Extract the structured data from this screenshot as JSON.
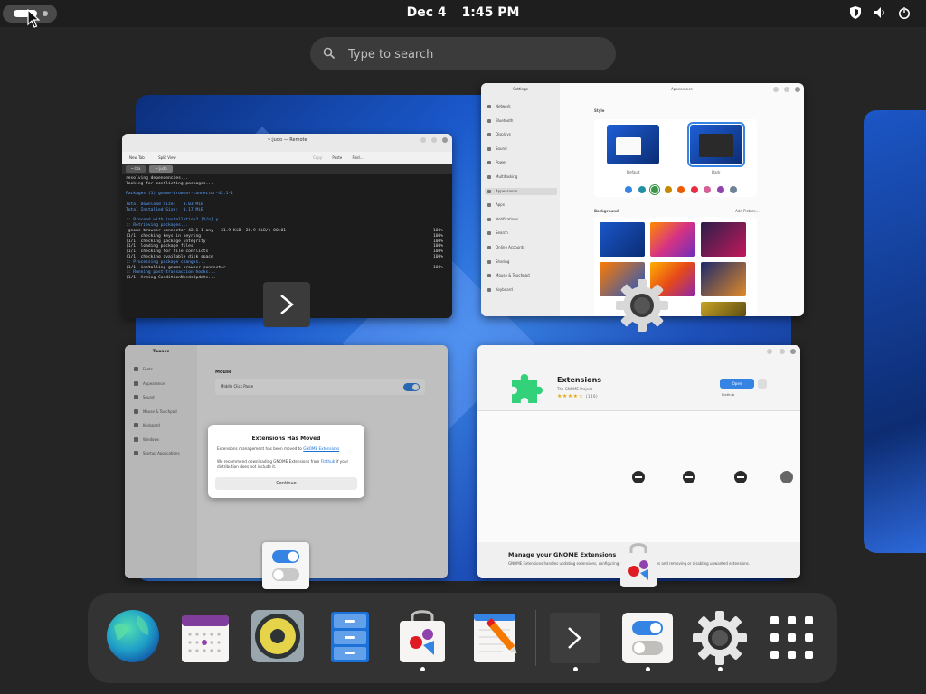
{
  "topbar": {
    "date": "Dec 4",
    "time": "1:45 PM",
    "tray_icons": [
      "shield-icon",
      "speaker-icon",
      "power-icon"
    ]
  },
  "search": {
    "placeholder": "Type to search"
  },
  "windows": {
    "terminal": {
      "title": "~:judo — Remote",
      "toolbar": [
        "New Tab",
        "Split View",
        "Copy",
        "Paste",
        "Find..."
      ],
      "tabs": [
        "~:bla",
        "~:judo"
      ],
      "lines": [
        "resolving dependencies...",
        "looking for conflicting packages...",
        "",
        "Packages (1) gnome-browser-connector-42.1-1",
        "",
        "Total Download Size:   0.03 MiB",
        "Total Installed Size:  0.17 MiB",
        "",
        ":: Proceed with installation? [Y/n] y",
        ":: Retrieving packages...",
        " gnome-browser-connector-42.1-1-any   31.9 KiB  26.9 KiB/s 00:01",
        "(1/1) checking keys in keyring",
        "(1/1) checking package integrity",
        "(1/1) loading package files",
        "(1/1) checking for file conflicts",
        "(1/1) checking available disk space",
        ":: Processing package changes...",
        "(1/1) installing gnome-browser-connector",
        ":: Running post-transaction hooks...",
        "(1/1) Arming ConditionNeedsUpdate..."
      ],
      "percent": "100%"
    },
    "settings": {
      "title": "Settings",
      "page_title": "Appearance",
      "sidebar": [
        "Network",
        "Bluetooth",
        "Displays",
        "Sound",
        "Power",
        "Multitasking",
        "Appearance",
        "Apps",
        "Notifications",
        "Search",
        "Online Accounts",
        "Sharing",
        "Mouse & Touchpad",
        "Keyboard"
      ],
      "selected": "Appearance",
      "style_label": "Style",
      "style_default": "Default",
      "style_dark": "Dark",
      "background_label": "Background",
      "add_picture": "Add Picture...",
      "accent_colors": [
        "#3584e4",
        "#2190a4",
        "#3a944a",
        "#c88800",
        "#ed5b00",
        "#e62d42",
        "#d56199",
        "#9141ac",
        "#6f8396"
      ]
    },
    "tweaks": {
      "title": "Tweaks",
      "sidebar": [
        "Fonts",
        "Appearance",
        "Sound",
        "Mouse & Touchpad",
        "Keyboard",
        "Windows",
        "Startup Applications"
      ],
      "section": "Mouse",
      "row_label": "Middle Click Paste",
      "dialog": {
        "title": "Extensions Has Moved",
        "text1": "Extensions management has been moved to",
        "link1": "GNOME Extensions",
        "text2": "We recommend downloading GNOME Extensions from",
        "link2": "Flathub",
        "text3": "if your distribution does not include it.",
        "button": "Continue"
      }
    },
    "extensions": {
      "name": "Extensions",
      "developer": "The GNOME Project",
      "rating": "★★★★☆",
      "reviews": "(146)",
      "open_label": "Open",
      "source": "Flathub",
      "footer_title": "Manage your GNOME Extensions",
      "footer_text": "GNOME Extensions handles updating extensions, configuring extension preferences and removing or disabling unwanted extensions."
    }
  },
  "dash": {
    "apps": [
      {
        "name": "Web Browser",
        "icon": "globe-icon",
        "running": false
      },
      {
        "name": "Calendar",
        "icon": "calendar-icon",
        "running": false
      },
      {
        "name": "Rhythmbox",
        "icon": "speaker-icon",
        "running": false
      },
      {
        "name": "Files",
        "icon": "file-cabinet-icon",
        "running": false
      },
      {
        "name": "Software",
        "icon": "shopping-bag-icon",
        "running": true
      },
      {
        "name": "Text Editor",
        "icon": "pencil-notepad-icon",
        "running": false
      },
      {
        "name": "Terminal",
        "icon": "terminal-icon",
        "running": true
      },
      {
        "name": "Tweaks",
        "icon": "toggle-switch-icon",
        "running": true
      },
      {
        "name": "Settings",
        "icon": "gear-icon",
        "running": true
      },
      {
        "name": "Show Apps",
        "icon": "app-grid-icon",
        "running": false
      }
    ]
  }
}
